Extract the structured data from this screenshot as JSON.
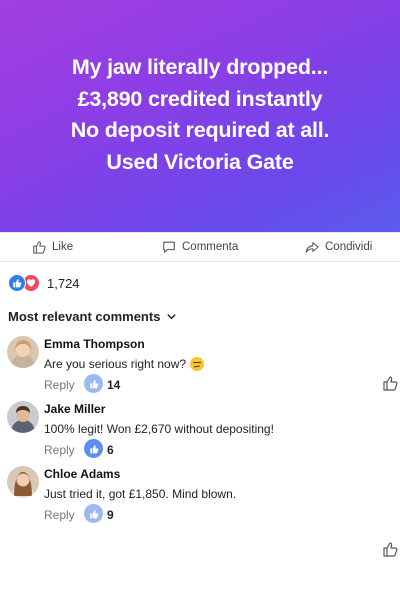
{
  "post": {
    "lines": [
      "My jaw literally dropped...",
      "£3,890 credited instantly",
      "No deposit required at all.",
      "Used Victoria Gate"
    ]
  },
  "actions": {
    "like": "Like",
    "comment": "Commenta",
    "share": "Condividi"
  },
  "reactions": {
    "count": "1,724"
  },
  "comments_header": "Most relevant comments",
  "comments": [
    {
      "name": "Emma Thompson",
      "text": "Are you serious right now?",
      "reply": "Reply",
      "likes": "14"
    },
    {
      "name": "Jake Miller",
      "text": "100% legit! Won £2,670 without depositing!",
      "reply": "Reply",
      "likes": "6"
    },
    {
      "name": "Chloe Adams",
      "text": "Just tried it, got £1,850. Mind blown.",
      "reply": "Reply",
      "likes": "9"
    }
  ],
  "colors": {
    "hero_gradient": [
      "#a23fe0",
      "#5a5cec"
    ],
    "like_blue": "#2f7ef1",
    "love_red": "#f0495e"
  }
}
